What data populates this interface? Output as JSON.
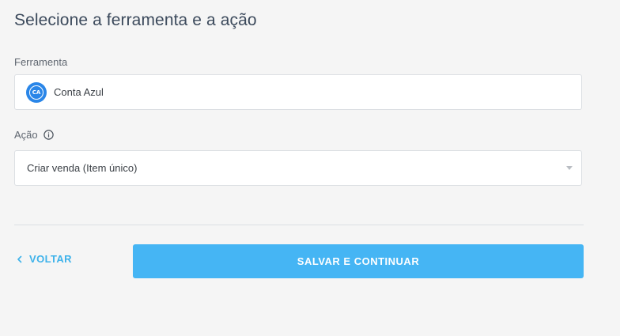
{
  "page": {
    "title": "Selecione a ferramenta e a ação"
  },
  "tool": {
    "label": "Ferramenta",
    "selected_name": "Conta Azul",
    "logo_text": "CA",
    "logo_color": "#2a86e8"
  },
  "action": {
    "label": "Ação",
    "info_icon": "info-circle-icon",
    "selected_value": "Criar venda (Item único)",
    "dropdown_icon": "caret-down-icon"
  },
  "footer": {
    "back_label": "VOLTAR",
    "back_icon": "chevron-left-icon",
    "save_label": "SALVAR E CONTINUAR",
    "accent_color": "#45b5f4",
    "link_color": "#3eb2ea"
  }
}
